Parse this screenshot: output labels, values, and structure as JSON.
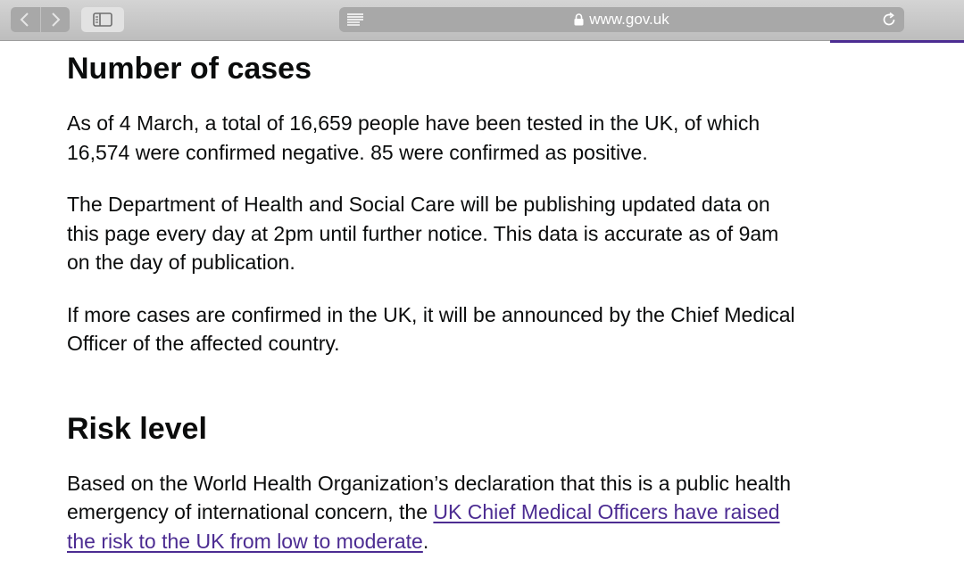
{
  "browser": {
    "url": "www.gov.uk",
    "back_icon": "chevron-left-icon",
    "forward_icon": "chevron-right-icon",
    "sidebar_icon": "sidebar-icon",
    "reader_icon": "reader-icon",
    "lock_icon": "lock-icon",
    "reload_icon": "reload-icon"
  },
  "colors": {
    "text": "#0b0c0c",
    "link": "#4c2c92",
    "toolbar": "#bdbdbd"
  },
  "section_cases": {
    "heading": "Number of cases",
    "paragraph_1": "As of 4 March, a total of 16,659 people have been tested in the UK, of which 16,574 were confirmed negative. 85 were confirmed as positive.",
    "paragraph_2": "The Department of Health and Social Care will be publishing updated data on this page every day at 2pm until further notice. This data is accurate as of 9am on the day of publication.",
    "paragraph_3": "If more cases are confirmed in the UK, it will be announced by the Chief Medical Officer of the affected country."
  },
  "section_risk": {
    "heading": "Risk level",
    "paragraph_text": "Based on the World Health Organization’s declaration that this is a public health emergency of international concern, the ",
    "link_text": "UK Chief Medical Officers have raised the risk to the UK from low to moderate",
    "paragraph_end": "."
  }
}
